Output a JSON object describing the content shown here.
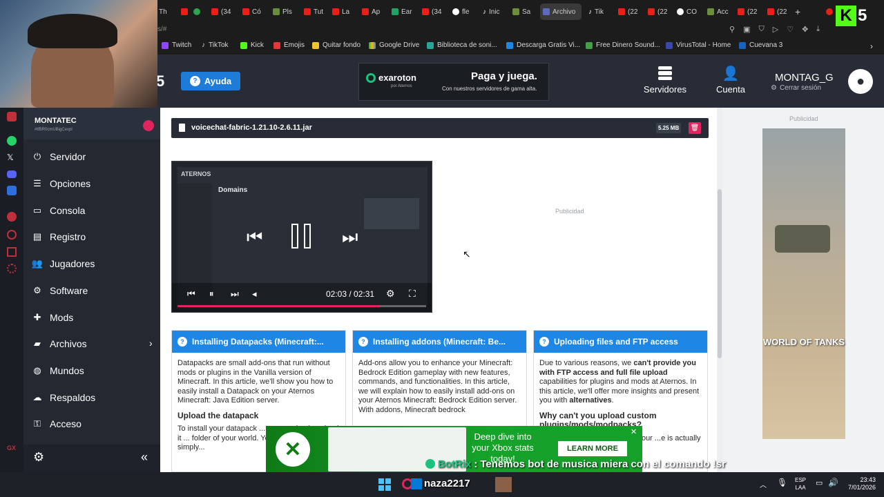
{
  "browser": {
    "tabs": [
      "Th",
      "(34",
      "Có",
      "Pls",
      "Tut",
      "La",
      "Ap",
      "Ear",
      "(34",
      "fle",
      "Inic",
      "Sa",
      "Archivo",
      "Tik",
      "(22",
      "(22",
      "CO",
      "Acc",
      "(22",
      "(22"
    ],
    "address": "s/#",
    "bookmarks": [
      "Twitch",
      "TikTok",
      "Kick",
      "Emojis",
      "Quitar fondo",
      "Google Drive",
      "Biblioteca de soni...",
      "Descarga Gratis Vi...",
      "Free Dinero Sound...",
      "VirusTotal - Home",
      "Cuevana 3"
    ]
  },
  "header": {
    "logo_digit": "5",
    "help_label": "Ayuda",
    "ad": {
      "brand": "exaroton",
      "brand_sub": "por Aternos",
      "headline": "Paga y juega.",
      "sub": "Con nuestros servidores de gama alta."
    },
    "servers_label": "Servidores",
    "account_label": "Cuenta",
    "username": "MONTAG_G",
    "logout_label": "Cerrar sesión"
  },
  "sidebar": {
    "server_name": "MONTATEC",
    "server_id": "#tfBR0cmUBigCevpl",
    "items": [
      {
        "label": "Servidor",
        "icon": "power-icon"
      },
      {
        "label": "Opciones",
        "icon": "sliders-icon"
      },
      {
        "label": "Consola",
        "icon": "terminal-icon"
      },
      {
        "label": "Registro",
        "icon": "file-icon"
      },
      {
        "label": "Jugadores",
        "icon": "users-icon"
      },
      {
        "label": "Software",
        "icon": "gear-icon"
      },
      {
        "label": "Mods",
        "icon": "puzzle-icon"
      },
      {
        "label": "Archivos",
        "icon": "folder-icon"
      },
      {
        "label": "Mundos",
        "icon": "globe-icon"
      },
      {
        "label": "Respaldos",
        "icon": "cloud-icon"
      },
      {
        "label": "Acceso",
        "icon": "key-icon"
      }
    ]
  },
  "file": {
    "name": "voicechat-fabric-1.21.10-2.6.11.jar",
    "size": "5.25 MB"
  },
  "video": {
    "title": "Domains",
    "brand": "ATERNOS",
    "time": "02:03 / 02:31",
    "progress": 0.81
  },
  "ad_label": "Publicidad",
  "cards": [
    {
      "title": "Installing Datapacks (Minecraft:...",
      "body": "Datapacks are small add-ons that run without mods or plugins in the Vanilla version of Minecraft. In this article, we'll show you how to easily install a Datapack on your Aternos Minecraft: Java Edition server.",
      "subheading": "Upload the datapack",
      "more": "To install your datapack ... server, simply upload it ... folder of your world. You... Upload button or simply..."
    },
    {
      "title": "Installing addons (Minecraft: Be...",
      "body": "Add-ons allow you to enhance your Minecraft: Bedrock Edition gameplay with new features, commands, and functionalities. In this article, we will explain how to easily install add-ons on your Aternos Minecraft: Bedrock Edition server. With addons, Minecraft bedrock",
      "subheading": "",
      "more": ""
    },
    {
      "title": "Uploading files and FTP access",
      "body_pre": "Due to various reasons, we ",
      "body_bold": "can't provide you with FTP access and full file upload",
      "body_mid": " capabilities for plugins and mods at Aternos. In this article, we'll offer more insights and present you with ",
      "body_bold2": "alternatives",
      "body_end": ".",
      "subheading": "Why can't you upload custom plugins/mods/modpacks?",
      "more": "...vice that ...of users ...sible, your ...e is actually"
    }
  ],
  "right_ad": {
    "label": "Publicidad",
    "brand": "WORLD OF TANKS"
  },
  "xbox_ad": {
    "line1": "Deep dive into",
    "line2": "your Xbox stats",
    "line3": "today!",
    "cta": "LEARN MORE"
  },
  "stream_overlay": {
    "logo": "5",
    "chat_user": "BotRix",
    "chat_message": "Tenemos bot de musica miera con el comando !sr"
  },
  "taskbar": {
    "search_text": "naza2217",
    "lang1": "ESP",
    "lang2": "LAA",
    "time": "23:43",
    "date": "7/01/2026"
  },
  "colors": {
    "accent": "#1e87e5",
    "header_bg": "#272c36",
    "sidebar_bg": "#232831",
    "delete": "#e0245e"
  }
}
